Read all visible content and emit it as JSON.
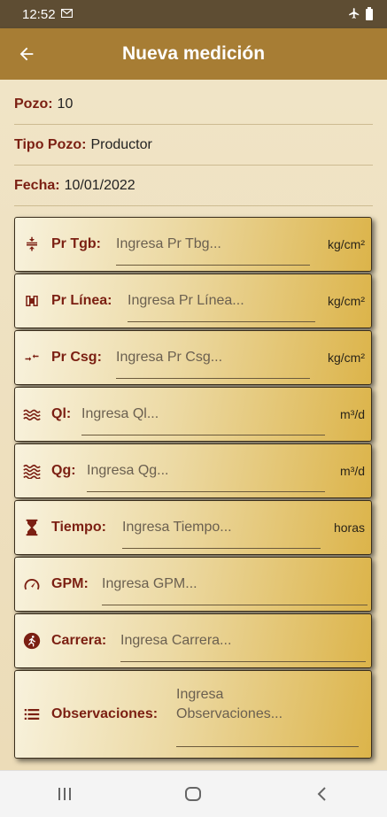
{
  "status_bar": {
    "time": "12:52",
    "mail_icon": "gmail-icon",
    "airplane_icon": "airplane-mode-icon",
    "battery_icon": "battery-icon"
  },
  "app_bar": {
    "title": "Nueva medición",
    "back_icon": "arrow-back-icon"
  },
  "info": {
    "pozo": {
      "label": "Pozo:",
      "value": "10"
    },
    "tipo": {
      "label": "Tipo Pozo:",
      "value": "Productor"
    },
    "fecha": {
      "label": "Fecha:",
      "value": "10/01/2022"
    }
  },
  "fields": [
    {
      "icon": "pressure-compress-icon",
      "label": "Pr Tgb:",
      "placeholder": "Ingresa Pr Tbg...",
      "unit": "kg/cm²"
    },
    {
      "icon": "pipeline-icon",
      "label": "Pr Línea:",
      "placeholder": "Ingresa Pr Línea...",
      "unit": "kg/cm²"
    },
    {
      "icon": "arrows-converge-icon",
      "label": "Pr Csg:",
      "placeholder": "Ingresa Pr Csg...",
      "unit": "kg/cm²"
    },
    {
      "icon": "waves-icon",
      "label": "Ql:",
      "placeholder": "Ingresa Ql...",
      "unit": "m³/d"
    },
    {
      "icon": "gas-waves-icon",
      "label": "Qg:",
      "placeholder": "Ingresa Qg...",
      "unit": "m³/d"
    },
    {
      "icon": "hourglass-icon",
      "label": "Tiempo:",
      "placeholder": "Ingresa Tiempo...",
      "unit": "horas"
    },
    {
      "icon": "speedometer-icon",
      "label": "GPM:",
      "placeholder": "Ingresa GPM...",
      "unit": ""
    },
    {
      "icon": "running-icon",
      "label": "Carrera:",
      "placeholder": "Ingresa Carrera...",
      "unit": ""
    },
    {
      "icon": "list-icon",
      "label": "Observaciones:",
      "placeholder_line1": "Ingresa",
      "placeholder_line2": "Observaciones...",
      "unit": ""
    }
  ],
  "nav_bar": {
    "recents_icon": "recents-icon",
    "home_icon": "home-icon",
    "back_icon": "nav-back-icon"
  },
  "colors": {
    "status_bar": "#5e4d33",
    "app_bar": "#a77d34",
    "label": "#7b1f12",
    "background": "#efe3c4",
    "field_gold": "#dcb44a"
  }
}
